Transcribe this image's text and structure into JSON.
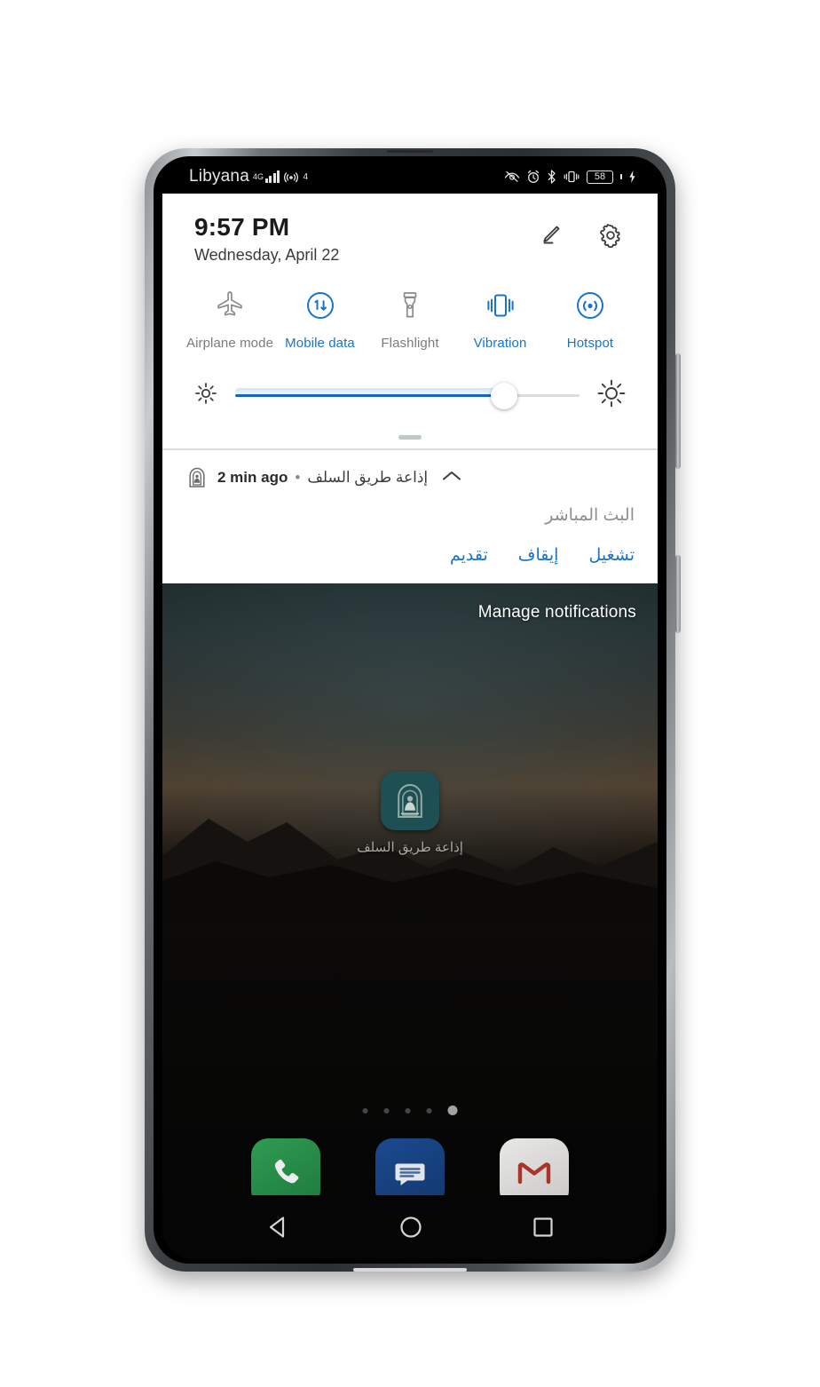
{
  "status_bar": {
    "carrier": "Libyana",
    "network_type": "4G",
    "wifi_superscript": "4",
    "battery_level": "58",
    "icons": [
      "eye-off-icon",
      "alarm-icon",
      "bluetooth-icon",
      "vibrate-icon",
      "battery-icon",
      "charging-bolt-icon"
    ]
  },
  "quick_settings": {
    "time": "9:57 PM",
    "date": "Wednesday, April 22",
    "edit_icon": "pencil-icon",
    "settings_icon": "gear-icon",
    "tiles": [
      {
        "label": "Airplane mode",
        "icon": "airplane-icon",
        "state": "off"
      },
      {
        "label": "Mobile data",
        "icon": "mobile-data-icon",
        "state": "on"
      },
      {
        "label": "Flashlight",
        "icon": "flashlight-icon",
        "state": "off"
      },
      {
        "label": "Vibration",
        "icon": "vibration-icon",
        "state": "on"
      },
      {
        "label": "Hotspot",
        "icon": "hotspot-icon",
        "state": "on"
      }
    ],
    "brightness": {
      "low_icon": "brightness-low-icon",
      "high_icon": "brightness-high-icon",
      "value_percent": 78
    },
    "drag_handle": "panel-drag-handle"
  },
  "notification": {
    "app_icon": "radio-arch-icon",
    "app_name": "إذاعة طريق السلف",
    "separator": "•",
    "time": "2 min ago",
    "collapse_icon": "chevron-up-icon",
    "body": "البث المباشر",
    "actions": [
      "تشغيل",
      "إيقاف",
      "تقديم"
    ]
  },
  "home": {
    "manage_notifications": "Manage notifications",
    "app_shortcut": {
      "label": "إذاعة طريق السلف",
      "icon": "radio-arch-icon",
      "icon_color": "#1e4f52"
    },
    "page_dots": {
      "count": 5,
      "active_index": 4
    },
    "dock": [
      {
        "name": "Phone",
        "icon": "phone-icon",
        "color": "#2f9b52"
      },
      {
        "name": "Messages",
        "icon": "messages-icon",
        "color": "#1b4a8f"
      },
      {
        "name": "Gmail",
        "icon": "gmail-icon",
        "color": "#e9e8e6"
      }
    ],
    "nav_bar": [
      {
        "name": "Back",
        "icon": "back-triangle-icon"
      },
      {
        "name": "Home",
        "icon": "home-circle-icon"
      },
      {
        "name": "Recents",
        "icon": "recents-square-icon"
      }
    ]
  },
  "colors": {
    "accent_blue": "#1a73c8",
    "slider_blue": "#1565c0",
    "inactive_gray": "#7b7b7b",
    "panel_bg": "#ffffff"
  }
}
